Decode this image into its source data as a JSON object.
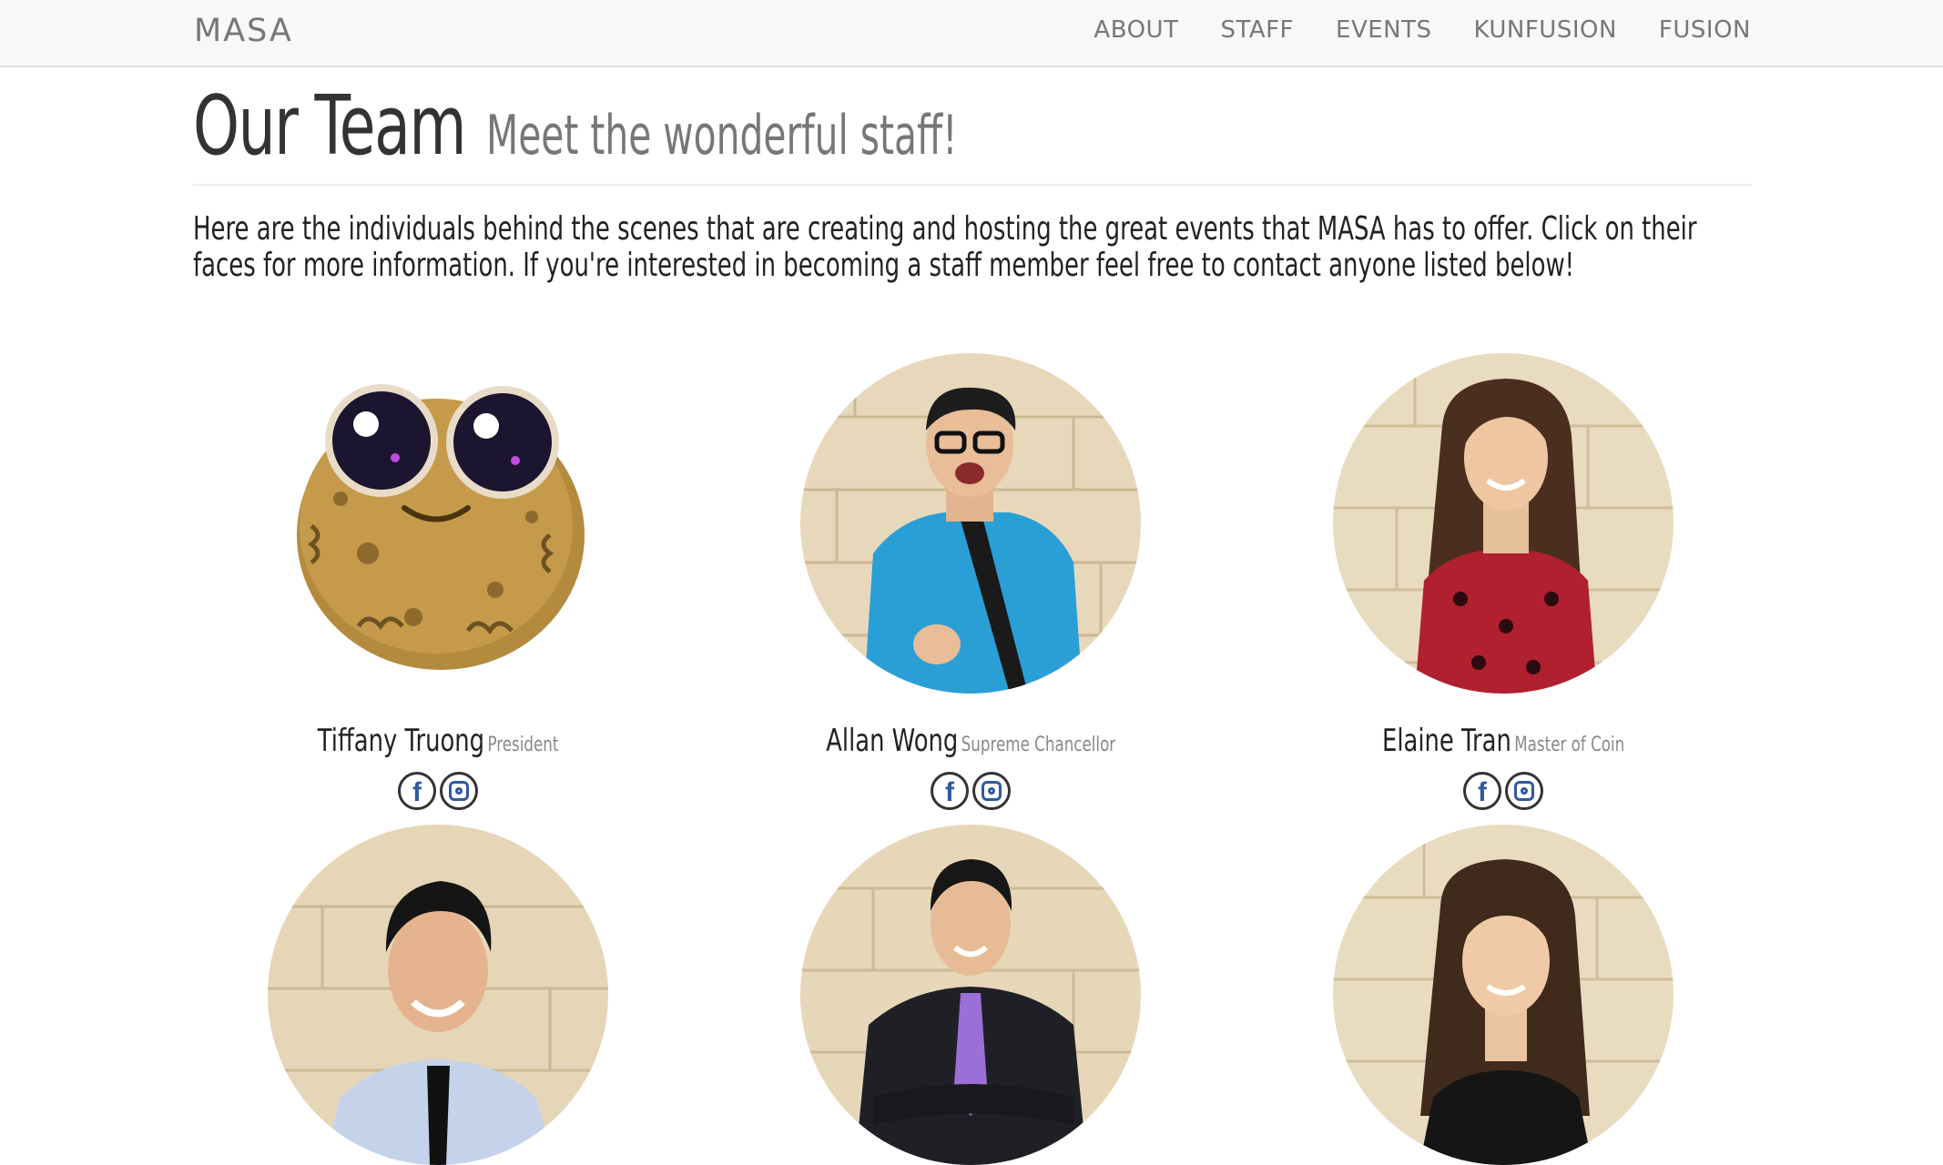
{
  "nav": {
    "brand": "MASA",
    "links": [
      "ABOUT",
      "STAFF",
      "EVENTS",
      "KUNFUSION",
      "FUSION"
    ]
  },
  "header": {
    "title": "Our Team",
    "subtitle": "Meet the wonderful staff!"
  },
  "intro": "Here are the individuals behind the scenes that are creating and hosting the great events that MASA has to offer. Click on their faces for more information. If you're interested in becoming a staff member feel free to contact anyone listed below!",
  "members": [
    {
      "name": "Tiffany Truong",
      "role": "President",
      "avatar": "potato-mascot-icon"
    },
    {
      "name": "Allan Wong",
      "role": "Supreme Chancellor",
      "avatar": "photo"
    },
    {
      "name": "Elaine Tran",
      "role": "Master of Coin",
      "avatar": "photo"
    },
    {
      "name": "",
      "role": "",
      "avatar": "photo"
    },
    {
      "name": "",
      "role": "",
      "avatar": "photo"
    },
    {
      "name": "",
      "role": "",
      "avatar": "photo"
    }
  ],
  "colors": {
    "navbar_bg": "#f8f8f8",
    "social_icon": "#2f5aa0",
    "wall": "#e6d6b8"
  }
}
